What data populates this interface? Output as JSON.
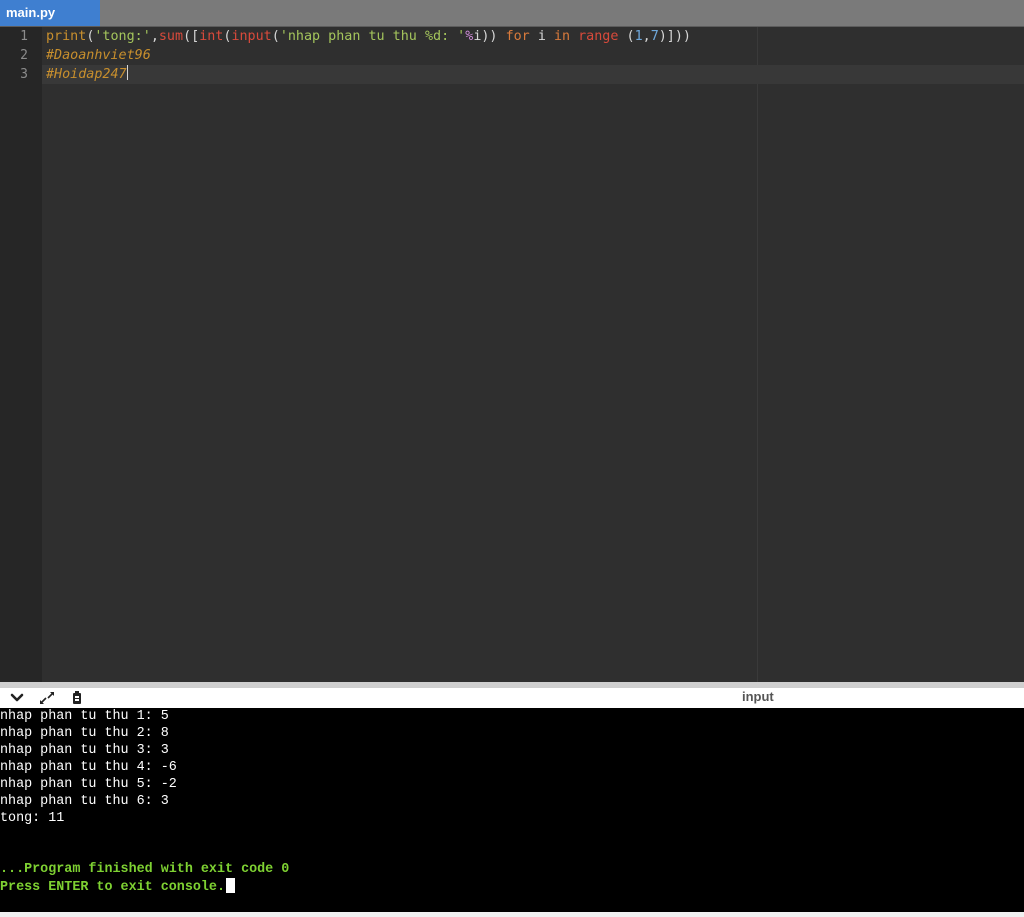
{
  "tab": {
    "filename": "main.py"
  },
  "editor": {
    "line_numbers": [
      "1",
      "2",
      "3"
    ],
    "line1": {
      "print": "print",
      "p1": "(",
      "str_tong": "'tong:'",
      "comma": ",",
      "sum": "sum",
      "p2": "([",
      "int": "int",
      "p3": "(",
      "input": "input",
      "p4": "(",
      "str_prompt": "'nhap phan tu thu ",
      "fmt": "%d",
      "str_prompt_end": ": '",
      "mod": "%",
      "var_i": "i",
      "p5": "))",
      "for": "for",
      "var_i2": "i",
      "in": "in",
      "range": "range",
      "p6": "(",
      "n1": "1",
      "comma2": ",",
      "n7": "7",
      "p7": ")]))"
    },
    "line2": "#Daoanhviet96",
    "line3": "#Hoidap247"
  },
  "toolbar": {
    "collapse_icon": "chevron-down-icon",
    "expand_icon": "expand-arrows-icon",
    "clear_icon": "clear-console-icon",
    "input_label": "input"
  },
  "console": {
    "output_lines": [
      "nhap phan tu thu 1: 5",
      "nhap phan tu thu 2: 8",
      "nhap phan tu thu 3: 3",
      "nhap phan tu thu 4: -6",
      "nhap phan tu thu 5: -2",
      "nhap phan tu thu 6: 3",
      "tong: 11"
    ],
    "finished_message": "...Program finished with exit code 0",
    "exit_prompt": "Press ENTER to exit console."
  },
  "colors": {
    "tab_active": "#3f7fd0",
    "editor_bg": "#2f2f2f",
    "console_bg": "#000000",
    "console_green": "#7ed132"
  }
}
